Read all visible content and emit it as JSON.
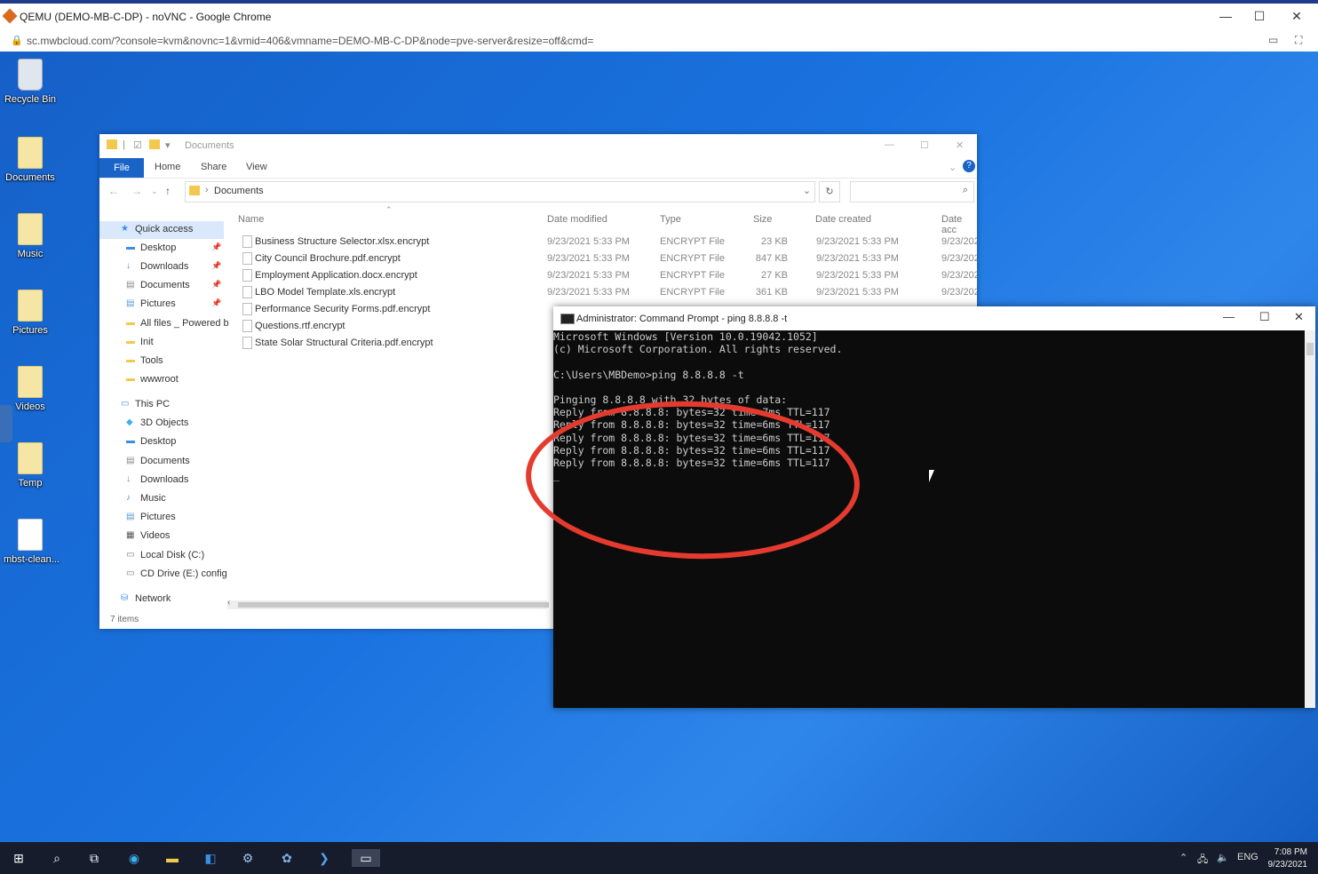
{
  "browser": {
    "title": "QEMU (DEMO-MB-C-DP) - noVNC - Google Chrome",
    "url": "sc.mwbcloud.com/?console=kvm&novnc=1&vmid=406&vmname=DEMO-MB-C-DP&node=pve-server&resize=off&cmd="
  },
  "desktop_icons": [
    {
      "label": "Recycle Bin",
      "kind": "bin"
    },
    {
      "label": "Documents",
      "kind": "folder"
    },
    {
      "label": "Music",
      "kind": "folder"
    },
    {
      "label": "Pictures",
      "kind": "folder"
    },
    {
      "label": "Videos",
      "kind": "folder"
    },
    {
      "label": "Temp",
      "kind": "folder"
    },
    {
      "label": "mbst-clean...",
      "kind": "file"
    }
  ],
  "explorer": {
    "title": "Documents",
    "ribbon": {
      "file": "File",
      "home": "Home",
      "share": "Share",
      "view": "View"
    },
    "path": "Documents",
    "nav": {
      "quick_access": "Quick access",
      "quick": [
        "Desktop",
        "Downloads",
        "Documents",
        "Pictures",
        "All files _ Powered b",
        "Init",
        "Tools",
        "wwwroot"
      ],
      "this_pc": "This PC",
      "pc": [
        "3D Objects",
        "Desktop",
        "Documents",
        "Downloads",
        "Music",
        "Pictures",
        "Videos",
        "Local Disk (C:)",
        "CD Drive (E:) config"
      ],
      "network": "Network"
    },
    "columns": {
      "name": "Name",
      "date_modified": "Date modified",
      "type": "Type",
      "size": "Size",
      "date_created": "Date created",
      "date_accessed": "Date acc"
    },
    "files": [
      {
        "name": "Business Structure Selector.xlsx.encrypt",
        "modified": "9/23/2021 5:33 PM",
        "type": "ENCRYPT File",
        "size": "23 KB",
        "created": "9/23/2021 5:33 PM",
        "accessed": "9/23/202"
      },
      {
        "name": "City Council Brochure.pdf.encrypt",
        "modified": "9/23/2021 5:33 PM",
        "type": "ENCRYPT File",
        "size": "847 KB",
        "created": "9/23/2021 5:33 PM",
        "accessed": "9/23/202"
      },
      {
        "name": "Employment Application.docx.encrypt",
        "modified": "9/23/2021 5:33 PM",
        "type": "ENCRYPT File",
        "size": "27 KB",
        "created": "9/23/2021 5:33 PM",
        "accessed": "9/23/202"
      },
      {
        "name": "LBO Model Template.xls.encrypt",
        "modified": "9/23/2021 5:33 PM",
        "type": "ENCRYPT File",
        "size": "361 KB",
        "created": "9/23/2021 5:33 PM",
        "accessed": "9/23/202"
      },
      {
        "name": "Performance Security Forms.pdf.encrypt",
        "modified": "",
        "type": "",
        "size": "",
        "created": "",
        "accessed": ""
      },
      {
        "name": "Questions.rtf.encrypt",
        "modified": "",
        "type": "",
        "size": "",
        "created": "",
        "accessed": ""
      },
      {
        "name": "State Solar Structural Criteria.pdf.encrypt",
        "modified": "",
        "type": "",
        "size": "",
        "created": "",
        "accessed": ""
      }
    ],
    "status": "7 items"
  },
  "cmd": {
    "title": "Administrator: Command Prompt - ping  8.8.8.8 -t",
    "lines": [
      "Microsoft Windows [Version 10.0.19042.1052]",
      "(c) Microsoft Corporation. All rights reserved.",
      "",
      "C:\\Users\\MBDemo>ping 8.8.8.8 -t",
      "",
      "Pinging 8.8.8.8 with 32 bytes of data:",
      "Reply from 8.8.8.8: bytes=32 time=7ms TTL=117",
      "Reply from 8.8.8.8: bytes=32 time=6ms TTL=117",
      "Reply from 8.8.8.8: bytes=32 time=6ms TTL=117",
      "Reply from 8.8.8.8: bytes=32 time=6ms TTL=117",
      "Reply from 8.8.8.8: bytes=32 time=6ms TTL=117",
      "_"
    ]
  },
  "taskbar": {
    "tray_lang": "ENG",
    "time": "7:08 PM",
    "date": "9/23/2021"
  },
  "colors": {
    "annotation": "#e53b2e",
    "accent": "#1a64c8"
  }
}
